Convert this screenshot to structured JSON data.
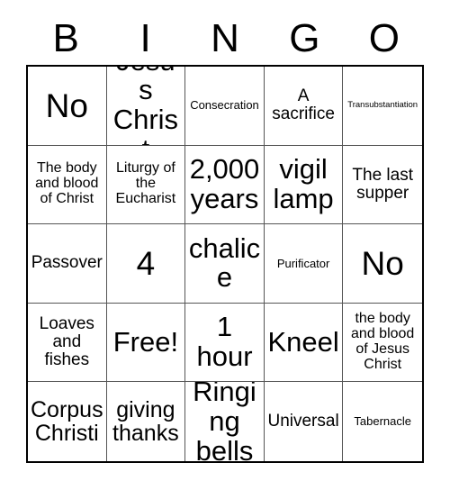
{
  "card": {
    "title_letters": [
      "B",
      "I",
      "N",
      "G",
      "O"
    ],
    "grid": {
      "rows": 5,
      "columns": 5,
      "border_color": "#000000",
      "inner_line_color": "#555555",
      "background": "#ffffff",
      "text_color": "#000000"
    },
    "cells": [
      {
        "text": "No",
        "size": "fs-xxl"
      },
      {
        "text": "Jesus Christ",
        "size": "fs-xl"
      },
      {
        "text": "Consecration",
        "size": "fs-xs"
      },
      {
        "text": "A sacrifice",
        "size": "fs-md"
      },
      {
        "text": "Transubstantiation",
        "size": "fs-xxs"
      },
      {
        "text": "The body and blood of Christ",
        "size": "fs-sm"
      },
      {
        "text": "Liturgy of the Eucharist",
        "size": "fs-sm"
      },
      {
        "text": "2,000 years",
        "size": "fs-xl"
      },
      {
        "text": "vigil lamp",
        "size": "fs-xl"
      },
      {
        "text": "The last supper",
        "size": "fs-md"
      },
      {
        "text": "Passover",
        "size": "fs-md"
      },
      {
        "text": "4",
        "size": "fs-xxl"
      },
      {
        "text": "chalice",
        "size": "fs-xl"
      },
      {
        "text": "Purificator",
        "size": "fs-xs"
      },
      {
        "text": "No",
        "size": "fs-xxl"
      },
      {
        "text": "Loaves and fishes",
        "size": "fs-md"
      },
      {
        "text": "Free!",
        "size": "fs-xl"
      },
      {
        "text": "1 hour",
        "size": "fs-xl"
      },
      {
        "text": "Kneel",
        "size": "fs-xl"
      },
      {
        "text": "the body and blood of Jesus Christ",
        "size": "fs-sm"
      },
      {
        "text": "Corpus Christi",
        "size": "fs-lg"
      },
      {
        "text": "giving thanks",
        "size": "fs-lg"
      },
      {
        "text": "Ringing bells",
        "size": "fs-xl"
      },
      {
        "text": "Universal",
        "size": "fs-md"
      },
      {
        "text": "Tabernacle",
        "size": "fs-xs"
      }
    ],
    "free_space_label": "Free!",
    "free_space_index": 16
  }
}
